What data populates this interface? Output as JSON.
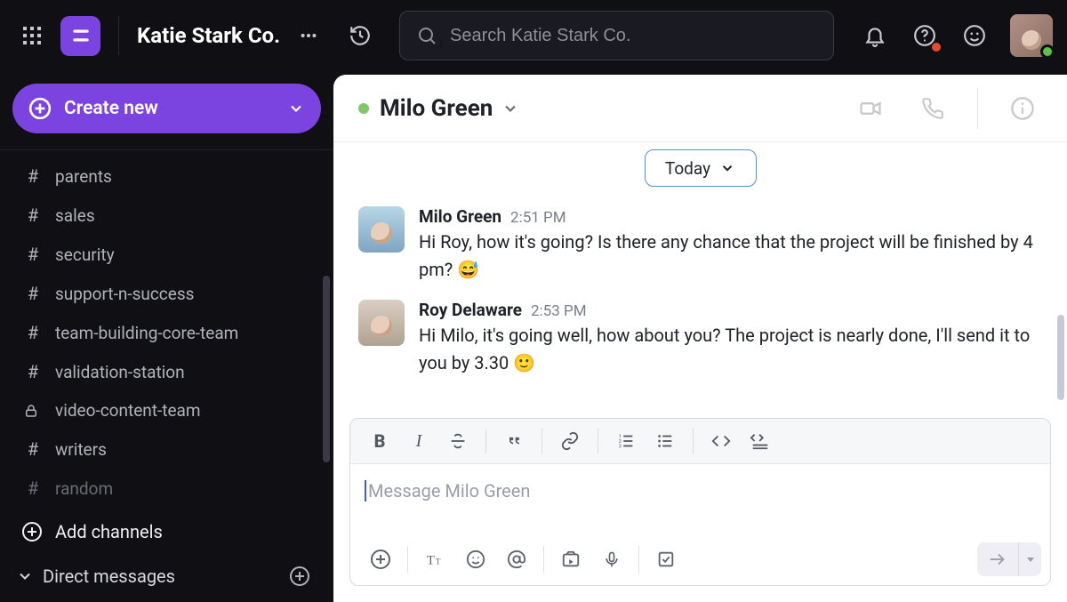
{
  "workspace": {
    "name": "Katie Stark Co."
  },
  "search": {
    "placeholder": "Search Katie Stark Co."
  },
  "sidebar": {
    "create_label": "Create new",
    "channels": [
      {
        "name": "parents",
        "icon": "hash",
        "muted": false
      },
      {
        "name": "sales",
        "icon": "hash",
        "muted": false
      },
      {
        "name": "security",
        "icon": "hash",
        "muted": false
      },
      {
        "name": "support-n-success",
        "icon": "hash",
        "muted": false
      },
      {
        "name": "team-building-core-team",
        "icon": "hash",
        "muted": false
      },
      {
        "name": "validation-station",
        "icon": "hash",
        "muted": false
      },
      {
        "name": "video-content-team",
        "icon": "lock",
        "muted": false
      },
      {
        "name": "writers",
        "icon": "hash",
        "muted": false
      },
      {
        "name": "random",
        "icon": "hash",
        "muted": true
      }
    ],
    "add_channels": "Add channels",
    "dm_header": "Direct messages"
  },
  "chat": {
    "title": "Milo Green",
    "date_divider": "Today",
    "messages": [
      {
        "author": "Milo Green",
        "time": "2:51 PM",
        "avatar": "milo",
        "text": "Hi Roy, how it's going? Is there any chance that the project will be finished by 4 pm? 😅"
      },
      {
        "author": "Roy Delaware",
        "time": "2:53 PM",
        "avatar": "roy",
        "text": "Hi Milo, it's going well, how about you? The project is nearly done, I'll send it to you by 3.30 🙂"
      }
    ],
    "composer_placeholder": "Message Milo Green"
  }
}
